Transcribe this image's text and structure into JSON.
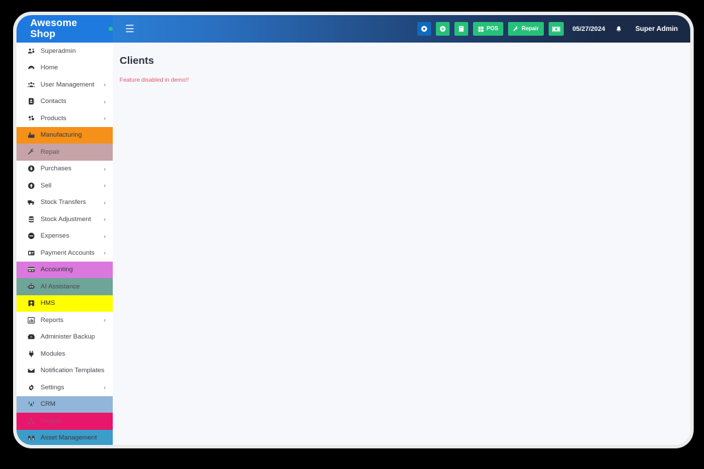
{
  "brand": {
    "name": "Awesome Shop",
    "status_dot": "online-dot",
    "color": "#1f7ae0"
  },
  "topbar": {
    "menu_toggle_icon": "hamburger-icon",
    "buttons": [
      {
        "id": "settings",
        "label": "",
        "icon": "gear-icon",
        "color": "#0f6bbd"
      },
      {
        "id": "add",
        "label": "",
        "icon": "plus-circle-icon",
        "color": "#27c07a"
      },
      {
        "id": "calculator",
        "label": "",
        "icon": "calculator-icon",
        "color": "#27c07a"
      },
      {
        "id": "pos",
        "label": "POS",
        "icon": "grid-icon",
        "color": "#27c07a"
      },
      {
        "id": "repair",
        "label": "Repair",
        "icon": "wrench-icon",
        "color": "#27c07a"
      },
      {
        "id": "cash",
        "label": "",
        "icon": "banknote-icon",
        "color": "#27c07a"
      }
    ],
    "date": "05/27/2024",
    "notification_icon": "bell-icon",
    "user": "Super Admin"
  },
  "sidebar": {
    "items": [
      {
        "label": "Superadmin",
        "icon": "users-cog-icon",
        "caret": "",
        "bg": "",
        "fg": "#4a4a52"
      },
      {
        "label": "Home",
        "icon": "dashboard-icon",
        "caret": "",
        "bg": "",
        "fg": "#4a4a52"
      },
      {
        "label": "User Management",
        "icon": "users-icon",
        "caret": "‹",
        "bg": "",
        "fg": "#4a4a52"
      },
      {
        "label": "Contacts",
        "icon": "address-book-icon",
        "caret": "‹",
        "bg": "",
        "fg": "#4a4a52"
      },
      {
        "label": "Products",
        "icon": "cubes-icon",
        "caret": "‹",
        "bg": "",
        "fg": "#4a4a52"
      },
      {
        "label": "Manufacturing",
        "icon": "factory-icon",
        "caret": "",
        "bg": "#f59019",
        "fg": "#3a3a42"
      },
      {
        "label": "Repair",
        "icon": "wrench-icon",
        "caret": "",
        "bg": "#c6a3a6",
        "fg": "#5a5a62"
      },
      {
        "label": "Purchases",
        "icon": "arrow-down-circle-icon",
        "caret": "‹",
        "bg": "",
        "fg": "#4a4a52"
      },
      {
        "label": "Sell",
        "icon": "arrow-up-circle-icon",
        "caret": "‹",
        "bg": "",
        "fg": "#4a4a52"
      },
      {
        "label": "Stock Transfers",
        "icon": "truck-icon",
        "caret": "‹",
        "bg": "",
        "fg": "#4a4a52"
      },
      {
        "label": "Stock Adjustment",
        "icon": "database-icon",
        "caret": "‹",
        "bg": "",
        "fg": "#4a4a52"
      },
      {
        "label": "Expenses",
        "icon": "minus-circle-icon",
        "caret": "‹",
        "bg": "",
        "fg": "#4a4a52"
      },
      {
        "label": "Payment Accounts",
        "icon": "card-icon",
        "caret": "‹",
        "bg": "",
        "fg": "#4a4a52"
      },
      {
        "label": "Accounting",
        "icon": "credit-card-icon",
        "caret": "",
        "bg": "#da78dd",
        "fg": "#3a3a42"
      },
      {
        "label": "AI Assistance",
        "icon": "robot-icon",
        "caret": "",
        "bg": "#6fa498",
        "fg": "#4a4a52"
      },
      {
        "label": "HMS",
        "icon": "hospital-icon",
        "caret": "",
        "bg": "#ffff00",
        "fg": "#2b2b33"
      },
      {
        "label": "Reports",
        "icon": "bar-chart-icon",
        "caret": "‹",
        "bg": "",
        "fg": "#4a4a52"
      },
      {
        "label": "Administer Backup",
        "icon": "archive-icon",
        "caret": "",
        "bg": "",
        "fg": "#4a4a52"
      },
      {
        "label": "Modules",
        "icon": "plug-icon",
        "caret": "",
        "bg": "",
        "fg": "#4a4a52"
      },
      {
        "label": "Notification Templates",
        "icon": "envelope-icon",
        "caret": "",
        "bg": "",
        "fg": "#4a4a52"
      },
      {
        "label": "Settings",
        "icon": "gear-icon",
        "caret": "‹",
        "bg": "",
        "fg": "#4a4a52"
      },
      {
        "label": "CRM",
        "icon": "broadcast-icon",
        "caret": "",
        "bg": "#91b6da",
        "fg": "#3a3a42"
      },
      {
        "label": "Project",
        "icon": "sitemap-icon",
        "caret": "",
        "bg": "#e8176c",
        "fg": "#9b4f72"
      },
      {
        "label": "Asset Management",
        "icon": "assets-icon",
        "caret": "",
        "bg": "#3b9dc9",
        "fg": "#3a3a42"
      }
    ],
    "bottom_strip_color": "#5b4bc4"
  },
  "content": {
    "title": "Clients",
    "message": "Feature disabled in demo!!",
    "message_color": "#e8546b"
  }
}
